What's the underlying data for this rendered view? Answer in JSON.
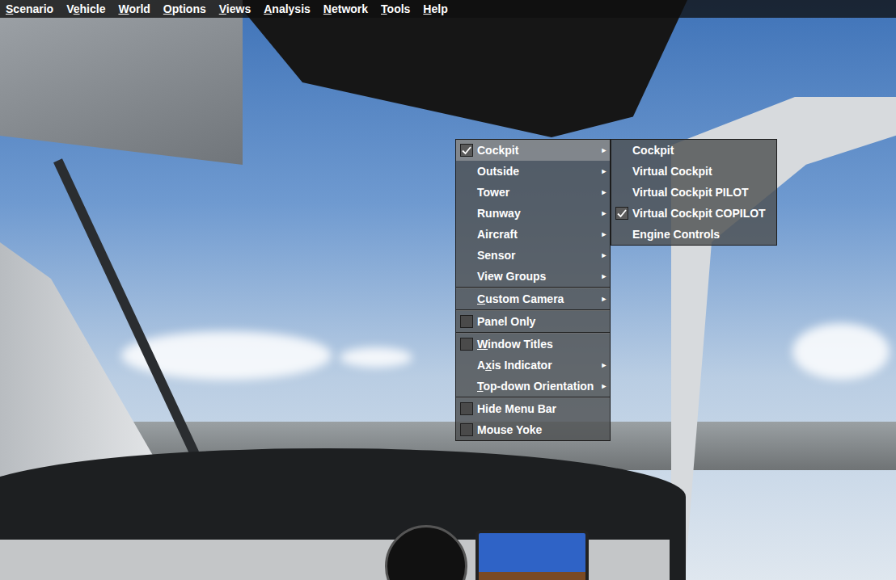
{
  "menu_bar": [
    {
      "label": "Scenario",
      "mnemonic": "S"
    },
    {
      "label": "Vehicle",
      "mnemonic": "e"
    },
    {
      "label": "World",
      "mnemonic": "W"
    },
    {
      "label": "Options",
      "mnemonic": "O"
    },
    {
      "label": "Views",
      "mnemonic": "V"
    },
    {
      "label": "Analysis",
      "mnemonic": "A"
    },
    {
      "label": "Network",
      "mnemonic": "N"
    },
    {
      "label": "Tools",
      "mnemonic": "T"
    },
    {
      "label": "Help",
      "mnemonic": "H"
    }
  ],
  "views_menu": {
    "items": [
      {
        "kind": "submenu",
        "label": "Cockpit",
        "mnemonic": "",
        "checked": true,
        "selected": true,
        "arrow": "►"
      },
      {
        "kind": "submenu",
        "label": "Outside",
        "mnemonic": "",
        "checked": false,
        "selected": false,
        "arrow": "►"
      },
      {
        "kind": "submenu",
        "label": "Tower",
        "mnemonic": "",
        "checked": false,
        "selected": false,
        "arrow": "►"
      },
      {
        "kind": "submenu",
        "label": "Runway",
        "mnemonic": "",
        "checked": false,
        "selected": false,
        "arrow": "►"
      },
      {
        "kind": "submenu",
        "label": "Aircraft",
        "mnemonic": "",
        "checked": false,
        "selected": false,
        "arrow": "►"
      },
      {
        "kind": "submenu",
        "label": "Sensor",
        "mnemonic": "",
        "checked": false,
        "selected": false,
        "arrow": "►"
      },
      {
        "kind": "submenu",
        "label": "View Groups",
        "mnemonic": "",
        "checked": false,
        "selected": false,
        "arrow": "►"
      },
      {
        "kind": "separator"
      },
      {
        "kind": "submenu",
        "label": "Custom Camera",
        "mnemonic": "C",
        "checked": false,
        "selected": false,
        "arrow": "►"
      },
      {
        "kind": "separator"
      },
      {
        "kind": "toggle",
        "label": "Panel Only",
        "mnemonic": "",
        "checked": false,
        "selected": false
      },
      {
        "kind": "separator"
      },
      {
        "kind": "toggle",
        "label": "Window Titles",
        "mnemonic": "W",
        "checked": false,
        "selected": false
      },
      {
        "kind": "submenu",
        "label": "Axis Indicator",
        "mnemonic": "x",
        "checked": false,
        "selected": false,
        "arrow": "►"
      },
      {
        "kind": "submenu",
        "label": "Top-down Orientation",
        "mnemonic": "T",
        "checked": false,
        "selected": false,
        "arrow": "►"
      },
      {
        "kind": "separator"
      },
      {
        "kind": "toggle",
        "label": "Hide Menu Bar",
        "mnemonic": "",
        "checked": false,
        "selected": false
      },
      {
        "kind": "toggle",
        "label": "Mouse Yoke",
        "mnemonic": "",
        "checked": false,
        "selected": false
      }
    ]
  },
  "cockpit_submenu": {
    "items": [
      {
        "label": "Cockpit",
        "checked": false
      },
      {
        "label": "Virtual Cockpit",
        "checked": false
      },
      {
        "label": "Virtual Cockpit PILOT",
        "checked": false
      },
      {
        "label": "Virtual Cockpit COPILOT",
        "checked": true
      },
      {
        "label": "Engine Controls",
        "checked": false
      }
    ]
  }
}
